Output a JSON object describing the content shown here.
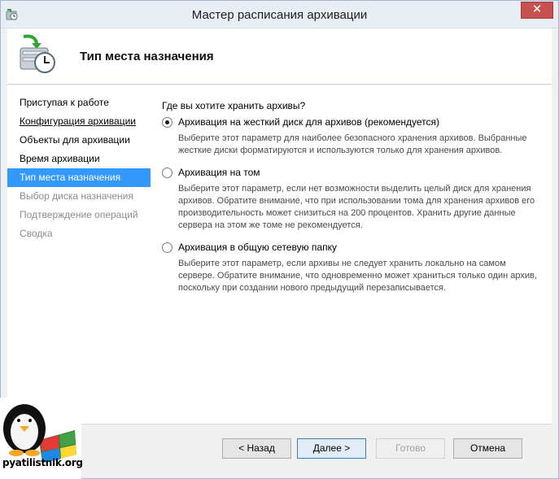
{
  "window": {
    "title": "Мастер расписания архивации",
    "close_glyph": "✕"
  },
  "header": {
    "title": "Тип места назначения",
    "icon": "backup-schedule-icon"
  },
  "nav": {
    "items": [
      {
        "label": "Приступая к работе",
        "state": "normal"
      },
      {
        "label": "Конфигурация архивации",
        "state": "underlined"
      },
      {
        "label": "Объекты для архивации",
        "state": "normal"
      },
      {
        "label": "Время архивации",
        "state": "normal"
      },
      {
        "label": "Тип места назначения",
        "state": "active"
      },
      {
        "label": "Выбор диска назначения",
        "state": "disabled"
      },
      {
        "label": "Подтверждение операций",
        "state": "disabled"
      },
      {
        "label": "Сводка",
        "state": "disabled"
      }
    ]
  },
  "panel": {
    "question": "Где вы хотите хранить архивы?",
    "options": [
      {
        "label": "Архивация на жесткий диск для архивов (рекомендуется)",
        "checked": true,
        "description": "Выберите этот параметр для наиболее безопасного хранения архивов. Выбранные жесткие диски форматируются и используются только для хранения архивов."
      },
      {
        "label": "Архивация на том",
        "checked": false,
        "description": "Выберите этот параметр, если нет возможности выделить целый диск для хранения архивов. Обратите внимание, что при использовании тома для хранения архивов его производительность может снизиться на 200 процентов. Хранить другие данные сервера на этом же томе не рекомендуется."
      },
      {
        "label": "Архивация в общую сетевую папку",
        "checked": false,
        "description": "Выберите этот параметр, если архивы не следует хранить локально на самом сервере. Обратите внимание, что одновременно может храниться только один архив, поскольку при создании нового предыдущий перезаписывается."
      }
    ]
  },
  "buttons": {
    "back": "< Назад",
    "next": "Далее >",
    "finish": "Готово",
    "cancel": "Отмена"
  },
  "logo": {
    "text": "pyatilistnik.org"
  },
  "colors": {
    "accent": "#3399ff",
    "close": "#c75050"
  }
}
